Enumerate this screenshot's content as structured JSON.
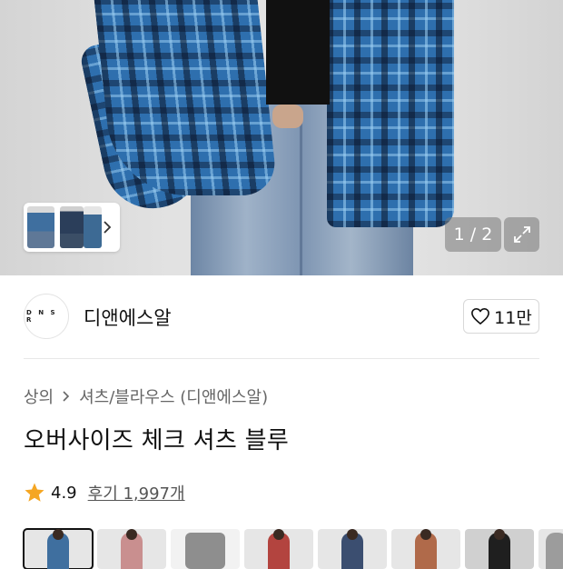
{
  "gallery": {
    "counter": "1 / 2",
    "thumbnail_arrow": "chevron-right-icon",
    "expand_icon": "expand-icon"
  },
  "brand": {
    "logo_text": "D N S R",
    "name": "디앤에스알",
    "like_count": "11만",
    "like_icon": "heart-outline-icon"
  },
  "breadcrumb": [
    "상의",
    "셔츠/블라우스 (디앤에스알)"
  ],
  "product": {
    "title": "오버사이즈 체크 셔츠 블루",
    "rating": "4.9",
    "reviews": "후기 1,997개",
    "star_color": "#f5a623"
  },
  "color_options": [
    "#3f6f9f",
    "#c98f8f",
    "#8e8e8e",
    "#b3443f",
    "#3b4e70",
    "#b06a4a",
    "#1f1f1f",
    "#9c9c9c"
  ]
}
